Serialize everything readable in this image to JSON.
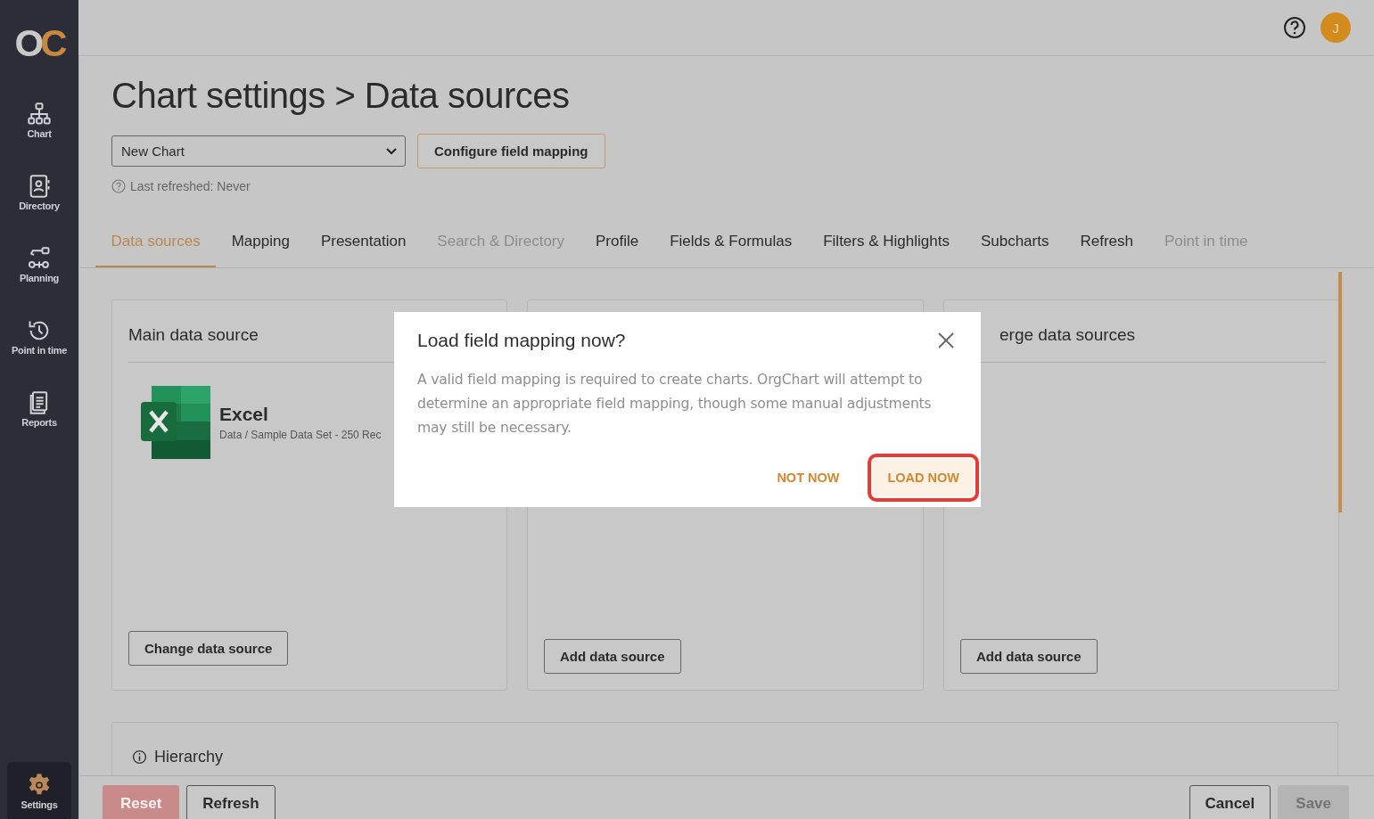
{
  "sidebar": {
    "logo": "OC",
    "items": [
      {
        "label": "Chart",
        "selected": false
      },
      {
        "label": "Directory",
        "selected": false
      },
      {
        "label": "Planning",
        "selected": false
      },
      {
        "label": "Point in time",
        "selected": false
      },
      {
        "label": "Reports",
        "selected": false
      }
    ],
    "settings": {
      "label": "Settings",
      "selected": true
    }
  },
  "header": {
    "avatar": "J"
  },
  "page": {
    "title": "Chart settings > Data sources",
    "chart_select": {
      "value": "New Chart"
    },
    "configure_button": "Configure field mapping",
    "last_refreshed": "Last refreshed: Never"
  },
  "tabs": [
    {
      "label": "Data sources",
      "selected": true,
      "disabled": false
    },
    {
      "label": "Mapping",
      "selected": false,
      "disabled": false
    },
    {
      "label": "Presentation",
      "selected": false,
      "disabled": false
    },
    {
      "label": "Search & Directory",
      "selected": false,
      "disabled": true
    },
    {
      "label": "Profile",
      "selected": false,
      "disabled": false
    },
    {
      "label": "Fields & Formulas",
      "selected": false,
      "disabled": false
    },
    {
      "label": "Filters & Highlights",
      "selected": false,
      "disabled": false
    },
    {
      "label": "Subcharts",
      "selected": false,
      "disabled": false
    },
    {
      "label": "Refresh",
      "selected": false,
      "disabled": false
    },
    {
      "label": "Point in time",
      "selected": false,
      "disabled": true
    }
  ],
  "cards": [
    {
      "title": "Main data source",
      "source": {
        "name": "Excel",
        "path": "Data / Sample Data Set - 250 Rec"
      },
      "button": "Change data source"
    },
    {
      "button": "Add data source"
    },
    {
      "title": "erge data sources",
      "button": "Add data source"
    }
  ],
  "hierarchy": {
    "title": "Hierarchy"
  },
  "footer": {
    "left": [
      {
        "label": "Reset",
        "disabled": true
      },
      {
        "label": "Refresh",
        "disabled": false
      }
    ],
    "right": [
      {
        "label": "Cancel",
        "disabled": false
      },
      {
        "label": "Save",
        "disabled": true
      }
    ]
  },
  "dialog": {
    "title": "Load field mapping now?",
    "message": "A valid field mapping is required to create charts. OrgChart will attempt to determine an appropriate field mapping, though some manual adjustments may still be necessary.",
    "actions": [
      {
        "label": "NOT NOW",
        "highlighted": false
      },
      {
        "label": "LOAD NOW",
        "highlighted": true
      }
    ]
  }
}
